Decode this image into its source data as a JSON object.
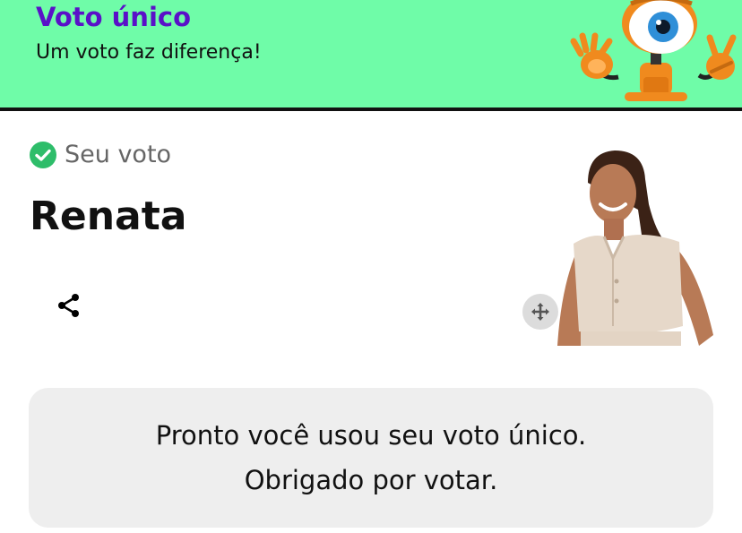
{
  "banner": {
    "title": "Voto único",
    "subtitle": "Um voto faz diferença!",
    "background_color": "#6ffca8",
    "title_color": "#5a10c8",
    "mascot_icon": "bbb-eye-mascot"
  },
  "vote": {
    "status_icon": "check-circle-icon",
    "status_color": "#2ebd6a",
    "status_label": "Seu voto",
    "candidate_name": "Renata",
    "share_icon": "share-icon",
    "move_icon": "move-arrows-icon"
  },
  "message": {
    "line1": "Pronto você usou seu voto único.",
    "line2": "Obrigado por votar."
  }
}
